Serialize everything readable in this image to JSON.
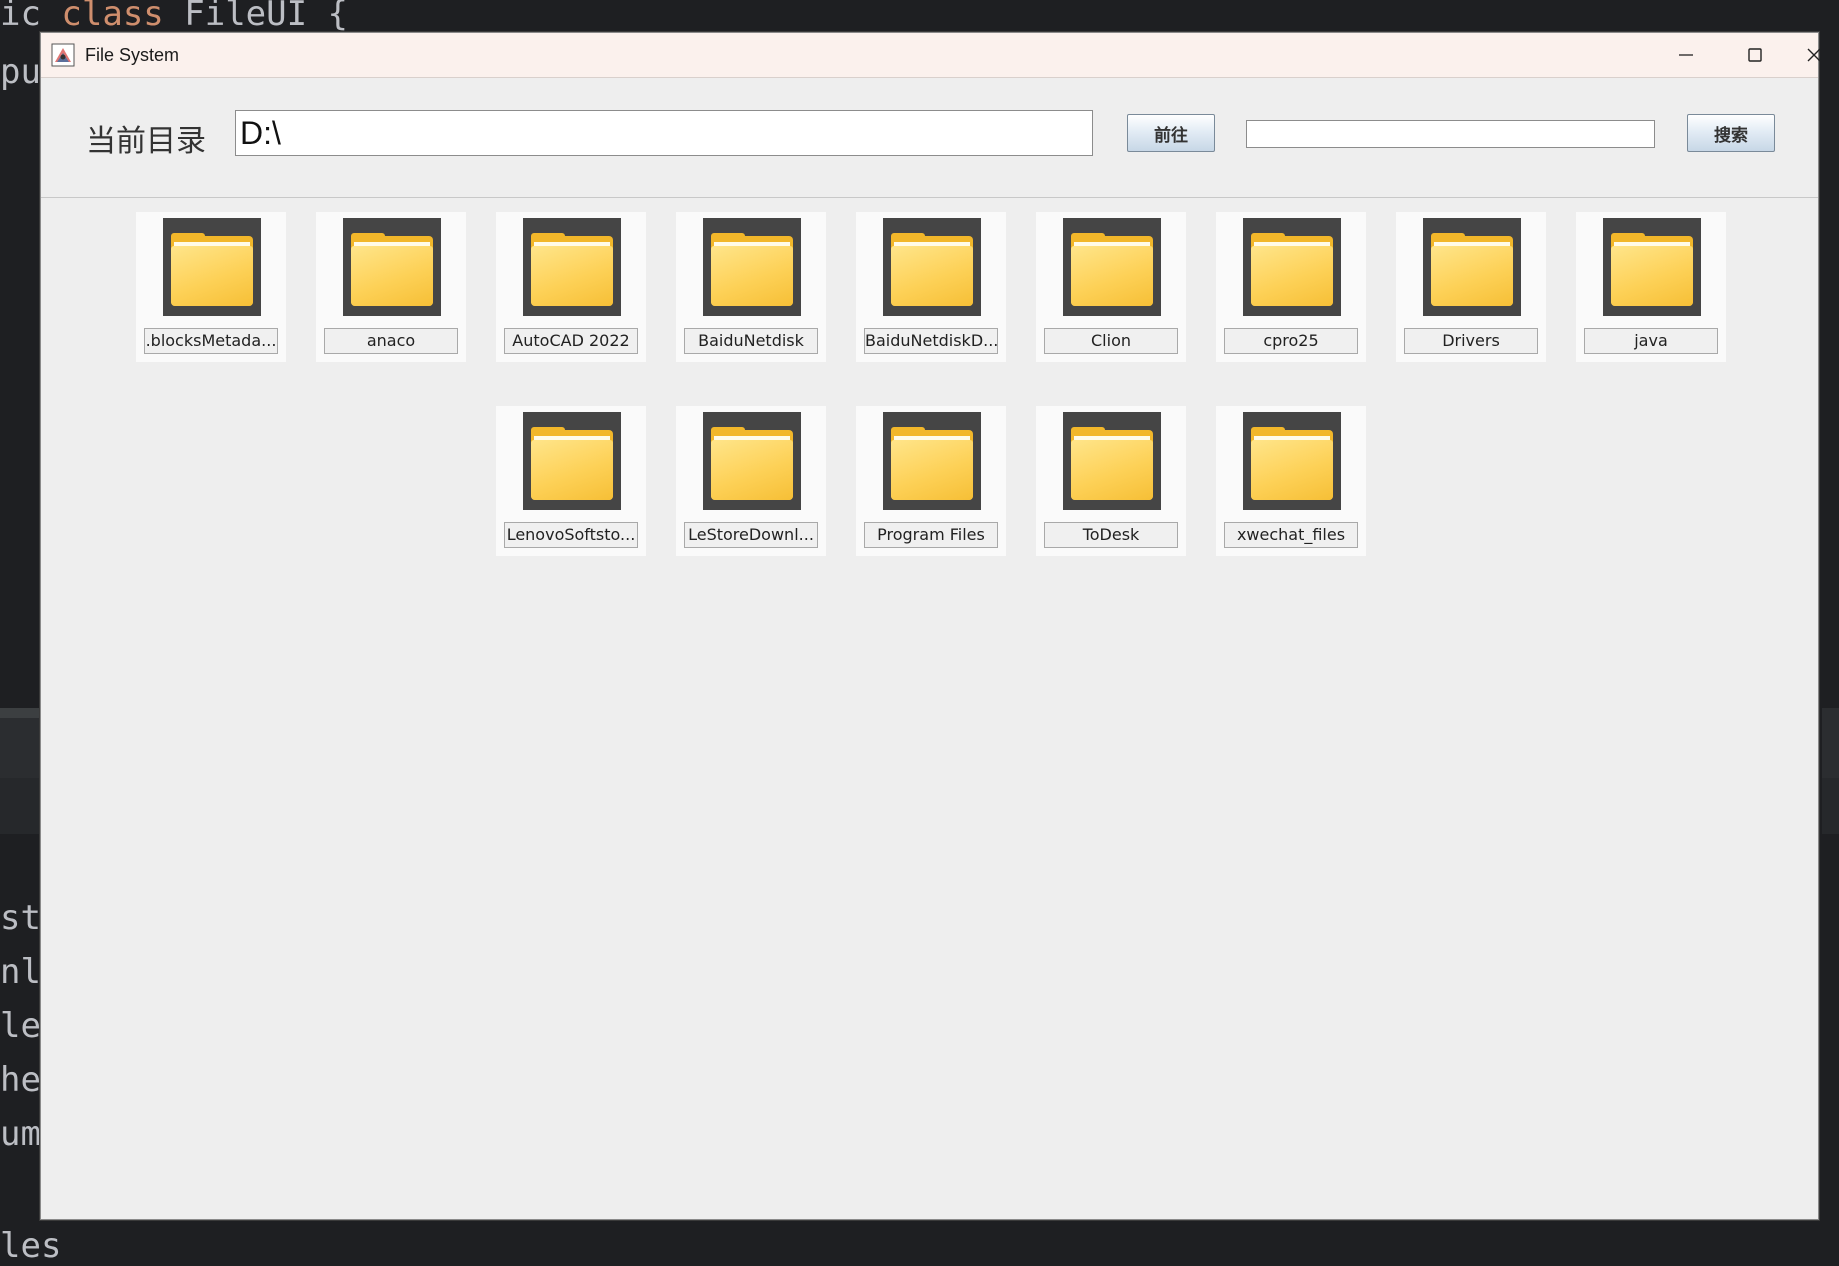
{
  "background": {
    "code_line_1": {
      "a": "ic ",
      "kw": "class",
      "b": " FileUI {"
    },
    "code_line_2": "pu",
    "code_side": [
      "st",
      "nl",
      "le",
      "he",
      "um",
      "les"
    ]
  },
  "window": {
    "title": "File System",
    "controls": {
      "minimize_icon": "minimize-icon",
      "maximize_icon": "maximize-icon",
      "close_icon": "close-icon"
    }
  },
  "toolbar": {
    "dir_label": "当前目录",
    "dir_value": "D:\\",
    "go_label": "前往",
    "search_value": "",
    "search_label": "搜索"
  },
  "folders": [
    {
      "name": ".blocksMetada..."
    },
    {
      "name": "anaco"
    },
    {
      "name": "AutoCAD 2022"
    },
    {
      "name": "BaiduNetdisk"
    },
    {
      "name": "BaiduNetdiskD..."
    },
    {
      "name": "Clion"
    },
    {
      "name": "cpro25"
    },
    {
      "name": "Drivers"
    },
    {
      "name": "java"
    },
    {
      "name": "LenovoSoftsto..."
    },
    {
      "name": "LeStoreDownl..."
    },
    {
      "name": "Program Files"
    },
    {
      "name": "ToDesk"
    },
    {
      "name": "xwechat_files"
    }
  ],
  "colors": {
    "folder": "#f6c544",
    "thumb_bg": "#454545",
    "titlebar": "#fbf1ed",
    "window_bg": "#eeeeee"
  }
}
